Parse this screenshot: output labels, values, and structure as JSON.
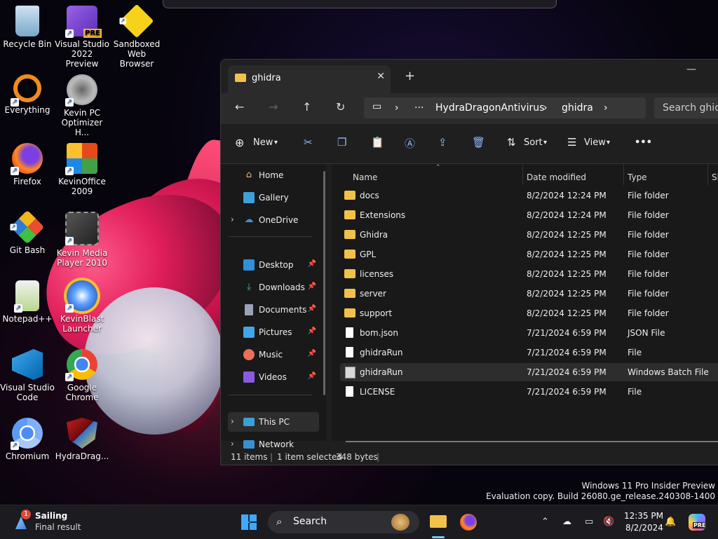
{
  "desktop": {
    "icons": [
      {
        "label": "Recycle Bin"
      },
      {
        "label": "Visual Studio 2022 Preview"
      },
      {
        "label": "Sandboxed Web Browser"
      },
      {
        "label": "Everything"
      },
      {
        "label": "Kevin PC Optimizer H..."
      },
      {
        "label": "Firefox"
      },
      {
        "label": "KevinOffice 2009"
      },
      {
        "label": "Git Bash"
      },
      {
        "label": "Kevin Media Player 2010"
      },
      {
        "label": "Notepad++"
      },
      {
        "label": "KevinBlast Launcher"
      },
      {
        "label": "Visual Studio Code"
      },
      {
        "label": "Google Chrome"
      },
      {
        "label": "Chromium"
      },
      {
        "label": "HydraDrag..."
      }
    ],
    "vs_badge": "PRE"
  },
  "explorer": {
    "tab_title": "ghidra",
    "close_glyph": "✕",
    "new_tab_glyph": "+",
    "minimize_glyph": "—",
    "address": {
      "more": "···",
      "segment1": "HydraDragonAntivirus",
      "segment2": "ghidra",
      "sep": "›"
    },
    "search_placeholder": "Search ghidra",
    "toolbar": {
      "new_label": "New",
      "sort_label": "Sort",
      "view_label": "View",
      "more": "•••"
    },
    "nav": {
      "home": "Home",
      "gallery": "Gallery",
      "onedrive": "OneDrive",
      "desktop": "Desktop",
      "downloads": "Downloads",
      "documents": "Documents",
      "pictures": "Pictures",
      "music": "Music",
      "videos": "Videos",
      "thispc": "This PC",
      "network": "Network"
    },
    "columns": {
      "name": "Name",
      "date": "Date modified",
      "type": "Type",
      "size": "Si"
    },
    "files": [
      {
        "name": "docs",
        "date": "8/2/2024 12:24 PM",
        "type": "File folder",
        "kind": "folder"
      },
      {
        "name": "Extensions",
        "date": "8/2/2024 12:24 PM",
        "type": "File folder",
        "kind": "folder"
      },
      {
        "name": "Ghidra",
        "date": "8/2/2024 12:25 PM",
        "type": "File folder",
        "kind": "folder"
      },
      {
        "name": "GPL",
        "date": "8/2/2024 12:25 PM",
        "type": "File folder",
        "kind": "folder"
      },
      {
        "name": "licenses",
        "date": "8/2/2024 12:25 PM",
        "type": "File folder",
        "kind": "folder"
      },
      {
        "name": "server",
        "date": "8/2/2024 12:25 PM",
        "type": "File folder",
        "kind": "folder"
      },
      {
        "name": "support",
        "date": "8/2/2024 12:25 PM",
        "type": "File folder",
        "kind": "folder"
      },
      {
        "name": "bom.json",
        "date": "7/21/2024 6:59 PM",
        "type": "JSON File",
        "kind": "file"
      },
      {
        "name": "ghidraRun",
        "date": "7/21/2024 6:59 PM",
        "type": "File",
        "kind": "file"
      },
      {
        "name": "ghidraRun",
        "date": "7/21/2024 6:59 PM",
        "type": "Windows Batch File",
        "kind": "bat"
      },
      {
        "name": "LICENSE",
        "date": "7/21/2024 6:59 PM",
        "type": "File",
        "kind": "file"
      }
    ],
    "status": {
      "count": "11 items",
      "selected": "1 item selected",
      "size": "348 bytes"
    }
  },
  "watermark": {
    "line1": "Windows 11 Pro Insider Preview",
    "line2": "Evaluation copy. Build 26080.ge_release.240308-1400"
  },
  "taskbar": {
    "weather_title": "Sailing",
    "weather_sub": "Final result",
    "badge": "1",
    "search_label": "Search",
    "time": "12:35 PM",
    "date": "8/2/2024",
    "copilot_badge": "PRE"
  }
}
